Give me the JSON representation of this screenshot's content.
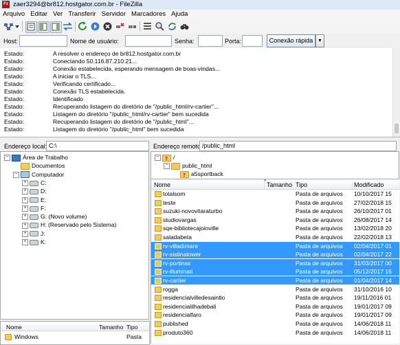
{
  "window": {
    "title": "zaer3294@br812.hostgator.com.br - FileZilla",
    "app_icon_letter": "Fz"
  },
  "menu": [
    "Arquivo",
    "Editar",
    "Ver",
    "Transferir",
    "Servidor",
    "Marcadores",
    "Ajuda"
  ],
  "toolbar": {
    "icons": [
      "site-manager-icon",
      "dropdown-arrow-icon",
      "toggle-log-icon",
      "toggle-local-tree-icon",
      "toggle-remote-tree-icon",
      "toggle-queue-icon",
      "refresh-icon",
      "process-queue-icon",
      "cancel-icon",
      "disconnect-icon",
      "reconnect-icon",
      "filter-icon",
      "compare-icon",
      "sync-browse-icon",
      "search-icon"
    ]
  },
  "quickconnect": {
    "host_label": "Host:",
    "host_value": "",
    "user_label": "Nome de usuário:",
    "user_value": "",
    "pass_label": "Senha:",
    "pass_value": "",
    "port_label": "Porta:",
    "port_value": "",
    "connect_button": "Conexão rápida",
    "dropdown_glyph": "▼"
  },
  "log": [
    {
      "k": "Estado:",
      "v": "A resolver o endereço de br812.hostgator.com.br"
    },
    {
      "k": "Estado:",
      "v": "Conectando 50.116.87.210:21..."
    },
    {
      "k": "Estado:",
      "v": "Conexão estabelecida, esperando mensagem de boas-vindas..."
    },
    {
      "k": "Estado:",
      "v": "A iniciar o TLS..."
    },
    {
      "k": "Estado:",
      "v": "Verificando certificado..."
    },
    {
      "k": "Estado:",
      "v": "Conexão TLS estabelecida."
    },
    {
      "k": "Estado:",
      "v": "Identificado"
    },
    {
      "k": "Estado:",
      "v": "Recuperando listagem do diretório de \"/public_html/rv-cartier\"..."
    },
    {
      "k": "Estado:",
      "v": "Listagem do diretório \"/public_html/rv-cartier\" bem sucedida"
    },
    {
      "k": "Estado:",
      "v": "Recuperando listagem do diretório de \"/public_html\"..."
    },
    {
      "k": "Estado:",
      "v": "Listagem do diretório \"/public_html\" bem sucedida"
    }
  ],
  "local": {
    "label": "Endereço local:",
    "path": "C:\\",
    "tree": [
      {
        "text": "Área de Trabalho",
        "icon": "desktop-icon",
        "expander": "−",
        "indent": 0
      },
      {
        "text": "Documentos",
        "icon": "folder-icon",
        "expander": "",
        "indent": 1
      },
      {
        "text": "Computador",
        "icon": "computer-icon",
        "expander": "−",
        "indent": 1
      },
      {
        "text": "C:",
        "icon": "drive-icon",
        "expander": "+",
        "indent": 2
      },
      {
        "text": "D:",
        "icon": "drive-icon",
        "expander": "+",
        "indent": 2
      },
      {
        "text": "E:",
        "icon": "drive-icon",
        "expander": "+",
        "indent": 2
      },
      {
        "text": "F:",
        "icon": "drive-icon",
        "expander": "+",
        "indent": 2
      },
      {
        "text": "G: (Novo volume)",
        "icon": "drive-icon",
        "expander": "+",
        "indent": 2
      },
      {
        "text": "H: (Reservado pelo Sistema)",
        "icon": "drive-icon",
        "expander": "+",
        "indent": 2
      },
      {
        "text": "J:",
        "icon": "drive-icon",
        "expander": "+",
        "indent": 2
      },
      {
        "text": "K:",
        "icon": "drive-icon",
        "expander": "+",
        "indent": 2
      }
    ],
    "list_headers": [
      "Nome",
      "Tamanho",
      "Tipo"
    ],
    "list_rows": [
      {
        "name": "Windows",
        "size": "",
        "type": "Pasta"
      }
    ]
  },
  "remote": {
    "label": "Endereço remoto:",
    "path": "/public_html",
    "tree": [
      {
        "text": "/",
        "icon": "unknown-folder-icon",
        "expander": "−",
        "indent": 0
      },
      {
        "text": "public_html",
        "icon": "folder-icon",
        "expander": "−",
        "indent": 1
      },
      {
        "text": "a5sportback",
        "icon": "unknown-folder-icon",
        "expander": "",
        "indent": 2
      }
    ],
    "headers": [
      "Nome",
      "Tamanho",
      "Tipo",
      "Modificado"
    ],
    "sort_indicator": "^",
    "files": [
      {
        "name": "totalsom",
        "size": "",
        "type": "Pasta de arquivos",
        "modified": "10/10/2017 15",
        "selected": false
      },
      {
        "name": "teste",
        "size": "",
        "type": "Pasta de arquivos",
        "modified": "27/02/2018 15",
        "selected": false
      },
      {
        "name": "suzuki-novovitaraturbo",
        "size": "",
        "type": "Pasta de arquivos",
        "modified": "26/10/2017 01",
        "selected": false
      },
      {
        "name": "studiovargas",
        "size": "",
        "type": "Pasta de arquivos",
        "modified": "26/08/2017 14",
        "selected": false
      },
      {
        "name": "sqe-bibliotecajoinville",
        "size": "",
        "type": "Pasta de arquivos",
        "modified": "13/02/2018 20",
        "selected": false
      },
      {
        "name": "saladabeta",
        "size": "",
        "type": "Pasta de arquivos",
        "modified": "22/02/2018 13",
        "selected": false
      },
      {
        "name": "rv-villadimare",
        "size": "",
        "type": "Pasta de arquivos",
        "modified": "02/04/2017 01",
        "selected": true
      },
      {
        "name": "rv-sistinatower",
        "size": "",
        "type": "Pasta de arquivos",
        "modified": "02/04/2017 22",
        "selected": true
      },
      {
        "name": "rv-portinax",
        "size": "",
        "type": "Pasta de arquivos",
        "modified": "31/03/2017 00",
        "selected": true
      },
      {
        "name": "rv-illuminati",
        "size": "",
        "type": "Pasta de arquivos",
        "modified": "05/12/2017 15",
        "selected": true
      },
      {
        "name": "rv-cartier",
        "size": "",
        "type": "Pasta de arquivos",
        "modified": "01/04/2017 14",
        "selected": true
      },
      {
        "name": "rogga",
        "size": "",
        "type": "Pasta de arquivos",
        "modified": "31/10/2016 10",
        "selected": false
      },
      {
        "name": "residencialvilledesaintlo",
        "size": "",
        "type": "Pasta de arquivos",
        "modified": "19/11/2016 01",
        "selected": false
      },
      {
        "name": "residencialilhadebali",
        "size": "",
        "type": "Pasta de arquivos",
        "modified": "19/01/2017 09",
        "selected": false
      },
      {
        "name": "residencialfaro",
        "size": "",
        "type": "Pasta de arquivos",
        "modified": "19/01/2017 09",
        "selected": false
      },
      {
        "name": "published",
        "size": "",
        "type": "Pasta de arquivos",
        "modified": "14/06/2018 11",
        "selected": false
      },
      {
        "name": "produto360",
        "size": "",
        "type": "Pasta de arquivos",
        "modified": "14/06/2018 11",
        "selected": false
      }
    ]
  }
}
